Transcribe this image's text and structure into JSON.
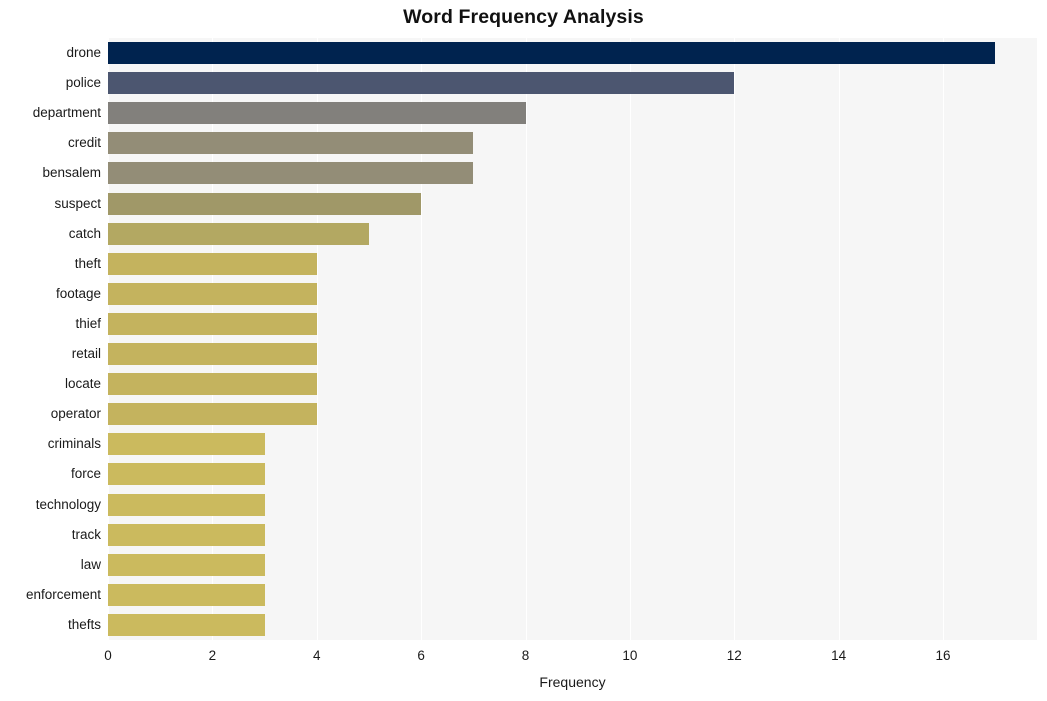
{
  "chart_data": {
    "type": "bar",
    "orientation": "horizontal",
    "title": "Word Frequency Analysis",
    "xlabel": "Frequency",
    "ylabel": "",
    "xlim": [
      0,
      17.8
    ],
    "xticks": [
      0,
      2,
      4,
      6,
      8,
      10,
      12,
      14,
      16
    ],
    "grid": true,
    "grid_axis": "x",
    "legend": "none",
    "categories": [
      "drone",
      "police",
      "department",
      "credit",
      "bensalem",
      "suspect",
      "catch",
      "theft",
      "footage",
      "thief",
      "retail",
      "locate",
      "operator",
      "criminals",
      "force",
      "technology",
      "track",
      "law",
      "enforcement",
      "thefts"
    ],
    "values": [
      17,
      12,
      8,
      7,
      7,
      6,
      5,
      4,
      4,
      4,
      4,
      4,
      4,
      3,
      3,
      3,
      3,
      3,
      3,
      3
    ],
    "bar_colors": [
      "#00234f",
      "#4c5670",
      "#82807c",
      "#938d77",
      "#938d77",
      "#a09868",
      "#b3a862",
      "#c4b35e",
      "#c4b35e",
      "#c4b35e",
      "#c4b35e",
      "#c4b35e",
      "#c4b35e",
      "#cbba5e",
      "#cbba5e",
      "#cbba5e",
      "#cbba5e",
      "#cbba5e",
      "#cbba5e",
      "#cbba5e"
    ],
    "plot_background": "#f6f6f6",
    "gridline_color": "#ffffff",
    "figure_background": "#ffffff"
  }
}
